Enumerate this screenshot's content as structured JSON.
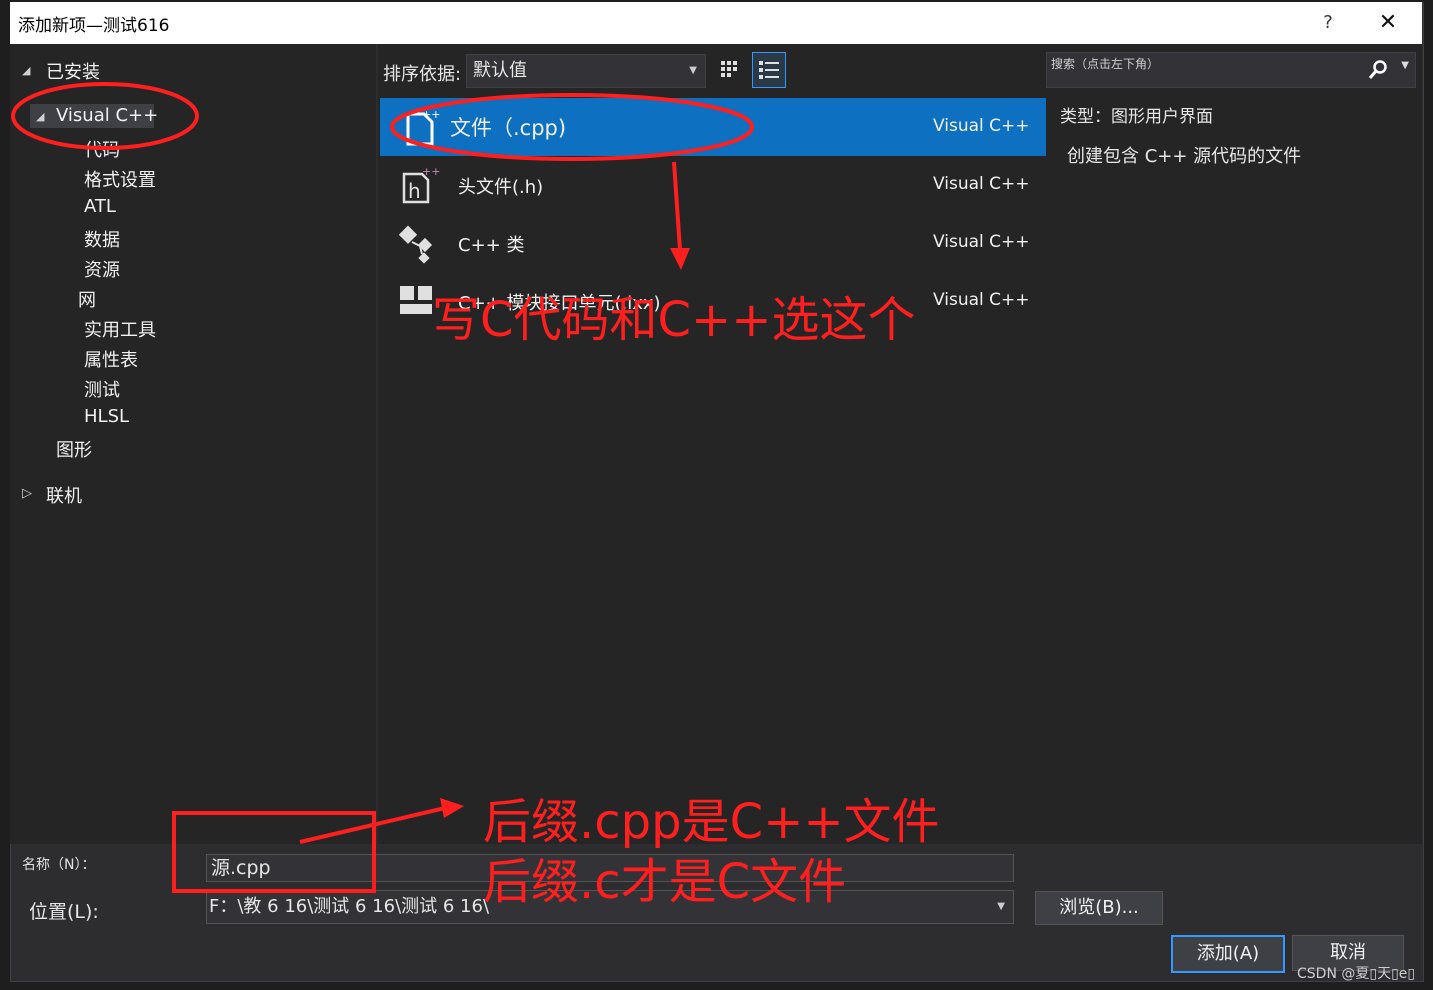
{
  "window": {
    "title": "添加新项—测试616",
    "help": "?",
    "close": "✕"
  },
  "tree": {
    "installed": "已安装",
    "visual_cpp": "Visual C++",
    "children": [
      "代码",
      "格式设置",
      "ATL",
      "数据",
      "资源",
      "网",
      "实用工具",
      "属性表",
      "测试",
      "HLSL"
    ],
    "graphics": "图形",
    "online": "联机"
  },
  "toolbar": {
    "sort_label": "排序依据:",
    "sort_value": "默认值"
  },
  "templates": [
    {
      "name": "文件（.cpp)",
      "lang": "Visual C++",
      "icon": "cpp-file-icon"
    },
    {
      "name": "头文件(.h)",
      "lang": "Visual C++",
      "icon": "header-file-icon"
    },
    {
      "name": "C++ 类",
      "lang": "Visual C++",
      "icon": "class-icon"
    },
    {
      "name": "C++ 模块接口单元(.ixx)",
      "lang": "Visual C++",
      "icon": "module-icon"
    }
  ],
  "details": {
    "search_placeholder": "搜索（点击左下角）",
    "type_line": "类型：图形用户界面",
    "description": "创建包含 C++ 源代码的文件"
  },
  "form": {
    "name_label": "名称（N）：",
    "name_value": "源.cpp",
    "location_label": "位置(L):",
    "location_value": "F：\\教 6 16\\测试 6 16\\测试 6 16\\"
  },
  "buttons": {
    "browse": "浏览(B)...",
    "add": "添加(A)",
    "cancel": "取消"
  },
  "annotations": {
    "top": "写C代码和C++选这个",
    "bottom_1": "后缀.cpp是C++文件",
    "bottom_2": "后缀.c才是C文件",
    "color": "#ff1f1f"
  },
  "watermark": "CSDN @夏▯天▯e▯"
}
